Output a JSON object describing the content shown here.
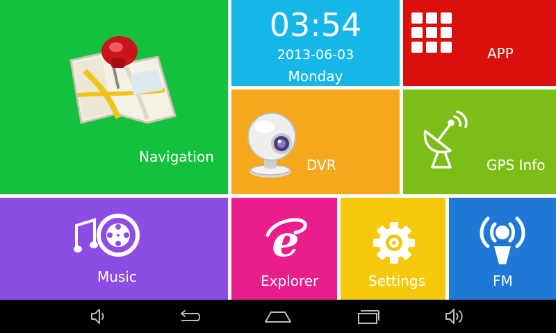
{
  "tiles": {
    "navigation": {
      "label": "Navigation",
      "icon": "map-pin-icon"
    },
    "clock": {
      "time": "03:54",
      "date": "2013-06-03",
      "day": "Monday"
    },
    "app": {
      "label": "APP",
      "icon": "app-grid-icon"
    },
    "dvr": {
      "label": "DVR",
      "icon": "webcam-icon"
    },
    "gps_info": {
      "label": "GPS Info",
      "icon": "satellite-dish-icon"
    },
    "music": {
      "label": "Music",
      "icon": "music-film-icon"
    },
    "explorer": {
      "label": "Explorer",
      "icon": "explorer-e-icon"
    },
    "settings": {
      "label": "Settings",
      "icon": "gear-icon"
    },
    "fm": {
      "label": "FM",
      "icon": "broadcast-person-icon"
    }
  },
  "navbar": {
    "buttons": [
      "volume-down-icon",
      "back-icon",
      "home-icon",
      "recent-apps-icon",
      "volume-up-icon"
    ]
  },
  "colors": {
    "navigation": "#14c13e",
    "clock": "#15b6e8",
    "app": "#d9100e",
    "dvr": "#f4a81b",
    "gps_info": "#7cbe17",
    "music": "#8d4de4",
    "explorer": "#e91d8b",
    "settings": "#f5c90b",
    "fm": "#1f78d6",
    "navbar": "#000000"
  }
}
